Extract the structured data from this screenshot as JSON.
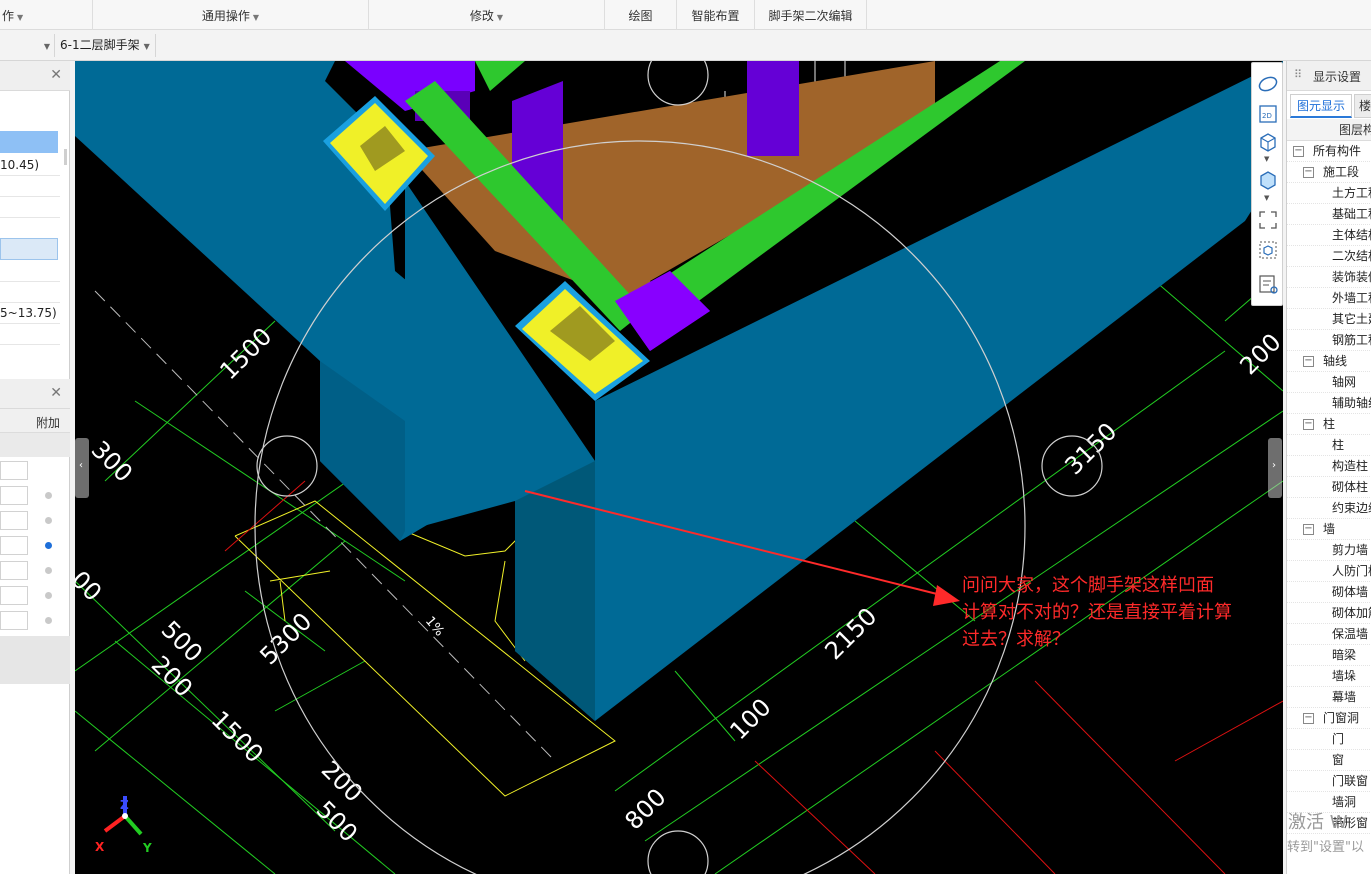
{
  "ribbon": {
    "tabs": [
      {
        "label": "作",
        "has_caret": true
      },
      {
        "label": "通用操作",
        "has_caret": true
      },
      {
        "label": "修改",
        "has_caret": true
      },
      {
        "label": "绘图",
        "has_caret": false
      },
      {
        "label": "智能布置",
        "has_caret": false
      },
      {
        "label": "脚手架二次编辑",
        "has_caret": false
      }
    ]
  },
  "toolbar2": {
    "left_select_value": "",
    "component_select_value": "6-1二层脚手架"
  },
  "left_panel": {
    "range_1": "10.45)",
    "range_2": "5~13.75)",
    "column_header": "附加"
  },
  "drawing": {
    "dimensions": [
      "1500",
      "300",
      "500",
      "200",
      "1500",
      "200",
      "500",
      "800",
      "100",
      "2150",
      "3150",
      "5300",
      "200",
      "00"
    ],
    "slope_label": "1%",
    "axes": {
      "x": "X",
      "y": "Y",
      "z": "Z"
    }
  },
  "annotation": {
    "line1": "问问大家，这个脚手架这样凹面",
    "line2": "计算对不对的？还是直接平着计算",
    "line3": "过去？求解？"
  },
  "right_panel": {
    "title": "显示设置",
    "tab_active": "图元显示",
    "tab_other": "楼",
    "column_header": "图层构",
    "tree": [
      {
        "label": "所有构件",
        "level": 0,
        "toggle": "−"
      },
      {
        "label": "施工段",
        "level": 1,
        "toggle": "−"
      },
      {
        "label": "土方工程",
        "level": 2
      },
      {
        "label": "基础工程",
        "level": 2
      },
      {
        "label": "主体结构",
        "level": 2
      },
      {
        "label": "二次结构",
        "level": 2
      },
      {
        "label": "装饰装修",
        "level": 2
      },
      {
        "label": "外墙工程",
        "level": 2
      },
      {
        "label": "其它土建",
        "level": 2
      },
      {
        "label": "钢筋工程",
        "level": 2
      },
      {
        "label": "轴线",
        "level": 1,
        "toggle": "−"
      },
      {
        "label": "轴网",
        "level": 2
      },
      {
        "label": "辅助轴线",
        "level": 2
      },
      {
        "label": "柱",
        "level": 1,
        "toggle": "−"
      },
      {
        "label": "柱",
        "level": 2
      },
      {
        "label": "构造柱",
        "level": 2
      },
      {
        "label": "砌体柱",
        "level": 2
      },
      {
        "label": "约束边缘",
        "level": 2
      },
      {
        "label": "墙",
        "level": 1,
        "toggle": "−"
      },
      {
        "label": "剪力墙",
        "level": 2
      },
      {
        "label": "人防门框",
        "level": 2
      },
      {
        "label": "砌体墙",
        "level": 2
      },
      {
        "label": "砌体加筋",
        "level": 2
      },
      {
        "label": "保温墙",
        "level": 2
      },
      {
        "label": "暗梁",
        "level": 2
      },
      {
        "label": "墙垛",
        "level": 2
      },
      {
        "label": "幕墙",
        "level": 2
      },
      {
        "label": "门窗洞",
        "level": 1,
        "toggle": "−"
      },
      {
        "label": "门",
        "level": 2
      },
      {
        "label": "窗",
        "level": 2
      },
      {
        "label": "门联窗",
        "level": 2
      },
      {
        "label": "墙洞",
        "level": 2
      },
      {
        "label": "带形窗",
        "level": 2
      }
    ]
  },
  "watermark": {
    "line1": "激活 W",
    "line2": "转到\"设置\"以"
  },
  "colors": {
    "wall_blue": "#006a96",
    "scaffold_green": "#2ec82e",
    "purple": "#7a00ff",
    "yellow": "#f0f028",
    "brown": "#a0642a",
    "annotation_red": "#ff2a2a"
  }
}
